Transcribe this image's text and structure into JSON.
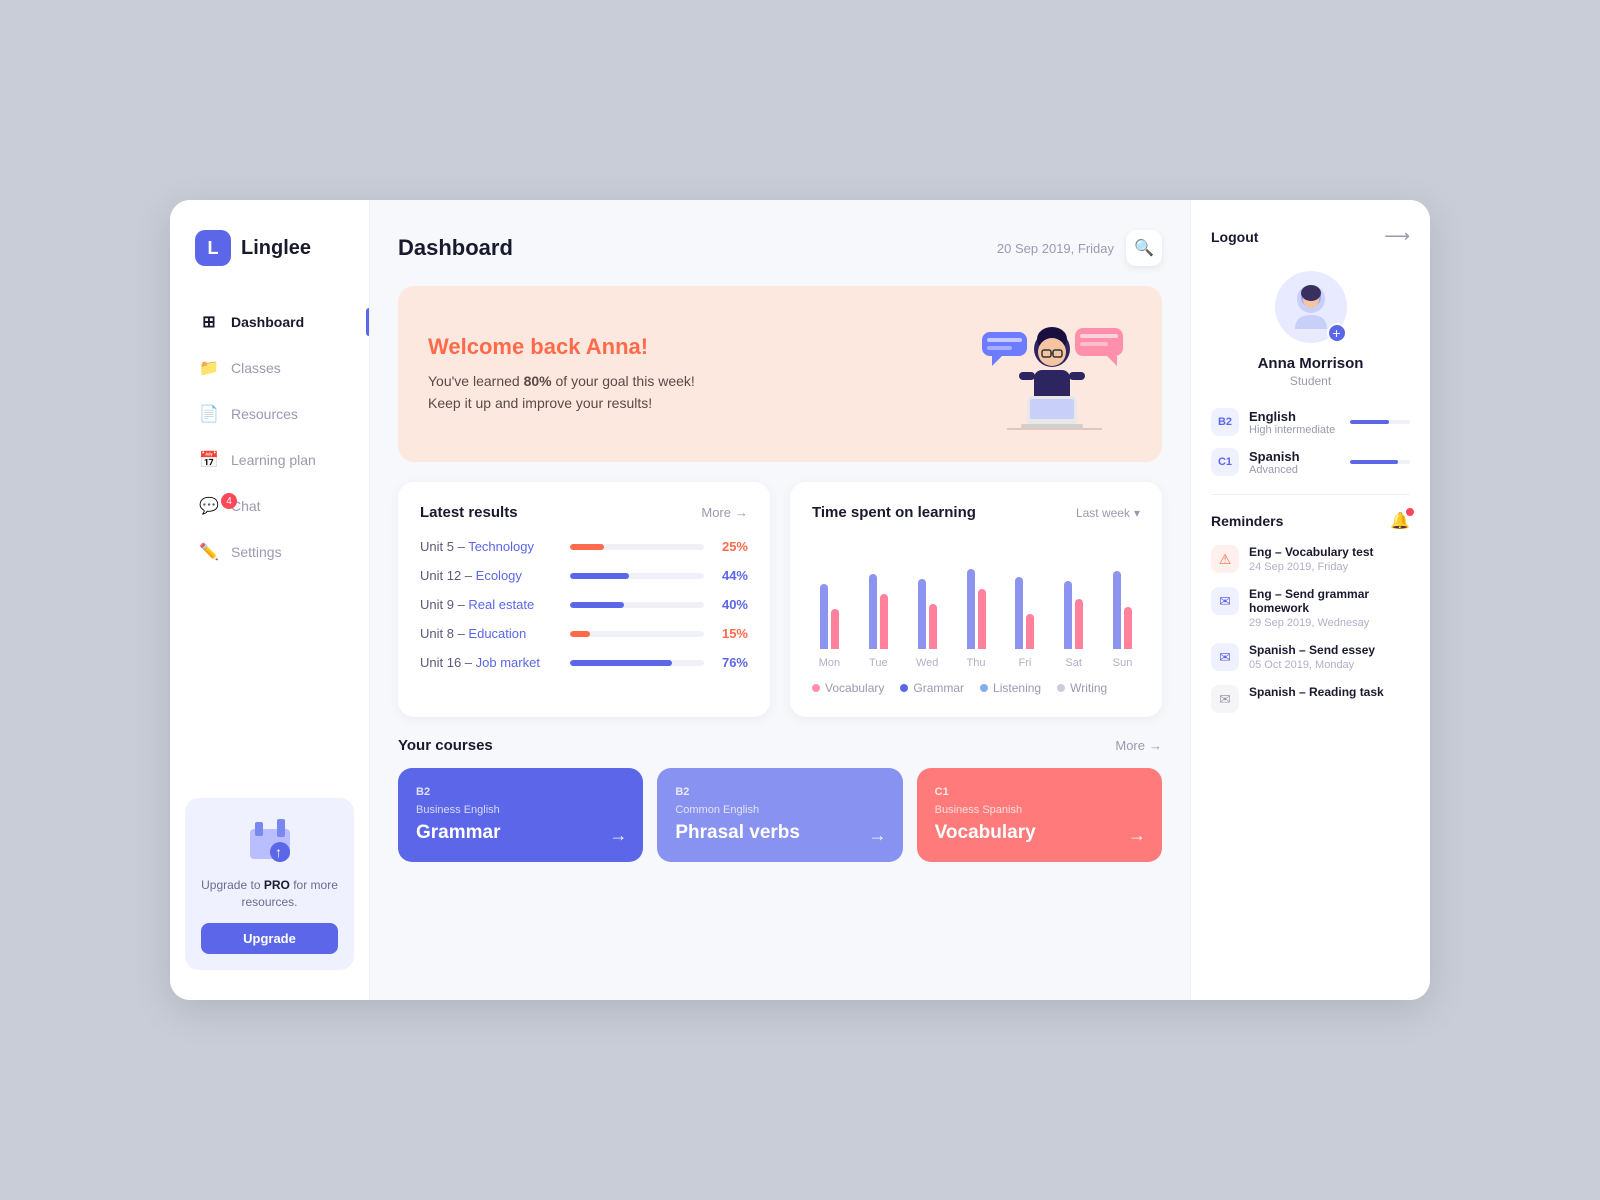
{
  "sidebar": {
    "logo_letter": "L",
    "logo_name": "Linglee",
    "nav": [
      {
        "id": "dashboard",
        "label": "Dashboard",
        "icon": "⊞",
        "active": true,
        "badge": false
      },
      {
        "id": "classes",
        "label": "Classes",
        "icon": "📁",
        "active": false,
        "badge": false
      },
      {
        "id": "resources",
        "label": "Resources",
        "icon": "📄",
        "active": false,
        "badge": false
      },
      {
        "id": "learning-plan",
        "label": "Learning plan",
        "icon": "📅",
        "active": false,
        "badge": false
      },
      {
        "id": "chat",
        "label": "Chat",
        "icon": "💬",
        "active": false,
        "badge": true,
        "badge_count": "4"
      },
      {
        "id": "settings",
        "label": "Settings",
        "icon": "✏️",
        "active": false,
        "badge": false
      }
    ],
    "upgrade_text_pre": "Upgrade to ",
    "upgrade_text_bold": "PRO",
    "upgrade_text_post": " for more resources.",
    "upgrade_btn": "Upgrade"
  },
  "header": {
    "title": "Dashboard",
    "date": "20 Sep 2019, Friday"
  },
  "welcome": {
    "greeting": "Welcome back Anna!",
    "line1_pre": "You've learned ",
    "line1_bold": "80%",
    "line1_post": " of your goal this week!",
    "line2": "Keep it up and improve your results!"
  },
  "results": {
    "title": "Latest results",
    "more": "More",
    "items": [
      {
        "label": "Unit 5 – ",
        "unit": "Technology",
        "pct": "25%",
        "pct_val": 25,
        "color": "red"
      },
      {
        "label": "Unit 12 – ",
        "unit": "Ecology",
        "pct": "44%",
        "pct_val": 44,
        "color": "blue"
      },
      {
        "label": "Unit 9 – ",
        "unit": "Real estate",
        "pct": "40%",
        "pct_val": 40,
        "color": "blue"
      },
      {
        "label": "Unit 8 – ",
        "unit": "Education",
        "pct": "15%",
        "pct_val": 15,
        "color": "red"
      },
      {
        "label": "Unit 16 – ",
        "unit": "Job market",
        "pct": "76%",
        "pct_val": 76,
        "color": "blue"
      }
    ]
  },
  "chart": {
    "title": "Time spent on learning",
    "week_selector": "Last week",
    "days": [
      {
        "label": "Mon",
        "blue": 65,
        "red": 40
      },
      {
        "label": "Tue",
        "blue": 75,
        "red": 55
      },
      {
        "label": "Wed",
        "blue": 70,
        "red": 45
      },
      {
        "label": "Thu",
        "blue": 80,
        "red": 60
      },
      {
        "label": "Fri",
        "blue": 72,
        "red": 35
      },
      {
        "label": "Sat",
        "blue": 68,
        "red": 50
      },
      {
        "label": "Sun",
        "blue": 78,
        "red": 42
      }
    ],
    "legend": [
      {
        "color": "#ff8fab",
        "label": "Vocabulary"
      },
      {
        "color": "#5b67e8",
        "label": "Grammar"
      },
      {
        "color": "#88aaee",
        "label": "Listening"
      },
      {
        "color": "#ccccdd",
        "label": "Writing"
      }
    ]
  },
  "courses": {
    "title": "Your courses",
    "more": "More",
    "items": [
      {
        "level": "B2",
        "type": "Business English",
        "name": "Grammar",
        "style": "blue"
      },
      {
        "level": "B2",
        "type": "Common English",
        "name": "Phrasal verbs",
        "style": "light-blue"
      },
      {
        "level": "C1",
        "type": "Business Spanish",
        "name": "Vocabulary",
        "style": "pink"
      }
    ]
  },
  "right_panel": {
    "logout_label": "Logout",
    "profile": {
      "name": "Anna Morrison",
      "role": "Student"
    },
    "languages": [
      {
        "level": "B2",
        "name": "English",
        "sub": "High intermediate",
        "bar": 65
      },
      {
        "level": "C1",
        "name": "Spanish",
        "sub": "Advanced",
        "bar": 80
      }
    ],
    "reminders_title": "Reminders",
    "reminders": [
      {
        "type": "alert",
        "title": "Eng – Vocabulary test",
        "date": "24 Sep 2019, Friday"
      },
      {
        "type": "mail",
        "title": "Eng – Send grammar homework",
        "date": "29 Sep 2019, Wednesay"
      },
      {
        "type": "mail",
        "title": "Spanish – Send essey",
        "date": "05 Oct 2019, Monday"
      },
      {
        "type": "gray",
        "title": "Spanish – Reading task",
        "date": ""
      }
    ]
  }
}
